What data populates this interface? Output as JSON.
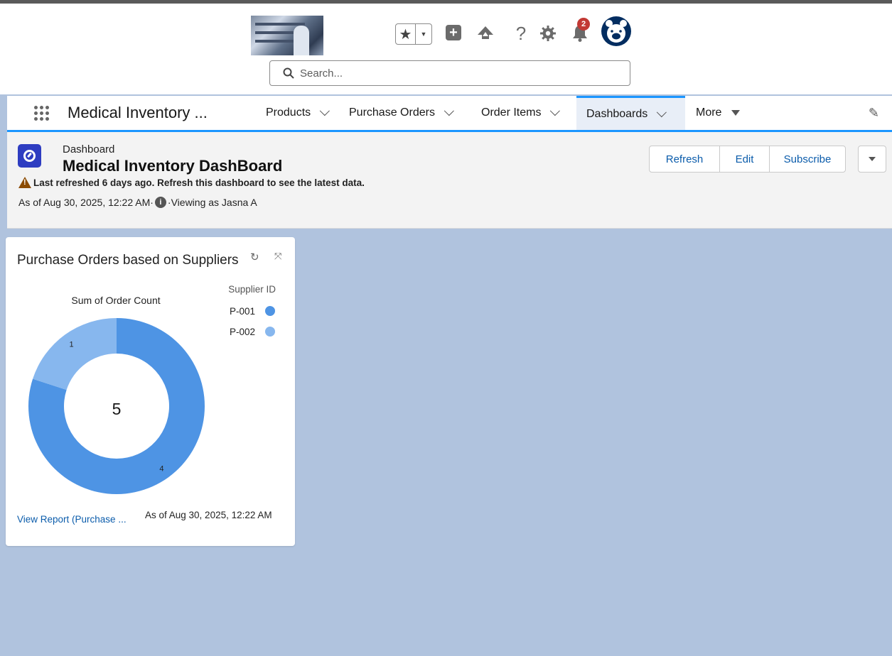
{
  "global_header": {
    "search_placeholder": "Search...",
    "notification_count": "2",
    "help_icon": "?",
    "icons": [
      "favorites-star-icon",
      "favorites-dropdown-icon",
      "global-create-icon",
      "trailhead-icon",
      "help-icon",
      "setup-gear-icon",
      "notifications-bell-icon",
      "user-avatar-icon"
    ]
  },
  "nav": {
    "app_name": "Medical Inventory ...",
    "items": [
      {
        "label": "Products"
      },
      {
        "label": "Purchase Orders"
      },
      {
        "label": "Order Items"
      },
      {
        "label": "Dashboards",
        "active": true
      },
      {
        "label": "More"
      }
    ]
  },
  "page_header": {
    "eyebrow": "Dashboard",
    "title": "Medical Inventory DashBoard",
    "warning": "Last refreshed 6 days ago. Refresh this dashboard to see the latest data.",
    "as_of": "As of Aug 30, 2025, 12:22 AM·",
    "viewing_as": "·Viewing as Jasna A",
    "buttons": {
      "refresh": "Refresh",
      "edit": "Edit",
      "subscribe": "Subscribe"
    }
  },
  "component": {
    "title": "Purchase Orders based on Suppliers",
    "view_report": "View Report (Purchase ...",
    "as_of": "As of Aug 30, 2025, 12:22 AM"
  },
  "chart_data": {
    "type": "pie",
    "donut": true,
    "title": "Sum of Order Count",
    "legend_title": "Supplier ID",
    "legend_position": "right",
    "center_total": "5",
    "slices": [
      {
        "label": "P-001",
        "value": 4,
        "color": "#4e94e4"
      },
      {
        "label": "P-002",
        "value": 1,
        "color": "#87b7ee"
      }
    ]
  },
  "colors": {
    "brand_blue": "#1b96ff",
    "link_blue": "#0b5cab",
    "canvas_bg": "#b0c3de",
    "dashboard_icon": "#2e3dc1",
    "warning": "#8c4b02",
    "badge_red": "#c23934"
  }
}
